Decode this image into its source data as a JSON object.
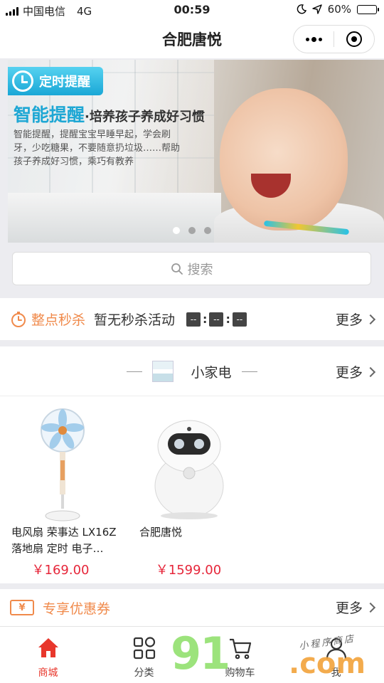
{
  "status_bar": {
    "carrier": "中国电信",
    "network": "4G",
    "time": "00:59",
    "battery": "60%",
    "battery_level": 0.6
  },
  "nav": {
    "title": "合肥唐悦"
  },
  "banner": {
    "tag": "定时提醒",
    "headline": "智能提醒",
    "headline_sub": "·培养孩子养成好习惯",
    "desc": "智能提醒，提醒宝宝早睡早起，学会刷牙，少吃糖果，不要随意扔垃圾……帮助孩子养成好习惯，乘巧有教养",
    "pages": 3,
    "active_page": 0
  },
  "search": {
    "placeholder": "搜索"
  },
  "seckill": {
    "title": "整点秒杀",
    "status": "暂无秒杀活动",
    "countdown": [
      "--",
      "--",
      "--"
    ],
    "more": "更多"
  },
  "category": {
    "name": "小家电",
    "more": "更多"
  },
  "products": [
    {
      "name": "电风扇 荣事达 LX16Z落地扇 定时 电子…",
      "price": "￥169.00"
    },
    {
      "name": "合肥唐悦",
      "price": "￥1599.00"
    }
  ],
  "coupon": {
    "title": "专享优惠券",
    "more": "更多",
    "icon_text": "¥"
  },
  "tabs": [
    {
      "label": "商城",
      "icon": "home-icon",
      "active": true
    },
    {
      "label": "分类",
      "icon": "category-grid-icon",
      "active": false
    },
    {
      "label": "购物车",
      "icon": "cart-icon",
      "active": false
    },
    {
      "label": "我",
      "icon": "user-icon",
      "active": false
    }
  ],
  "watermark": {
    "main": "91",
    "suffix": ".com",
    "small": "小程序商店"
  },
  "colors": {
    "accent": "#e8372c",
    "orange": "#f08a4b",
    "price": "#e6263a"
  }
}
